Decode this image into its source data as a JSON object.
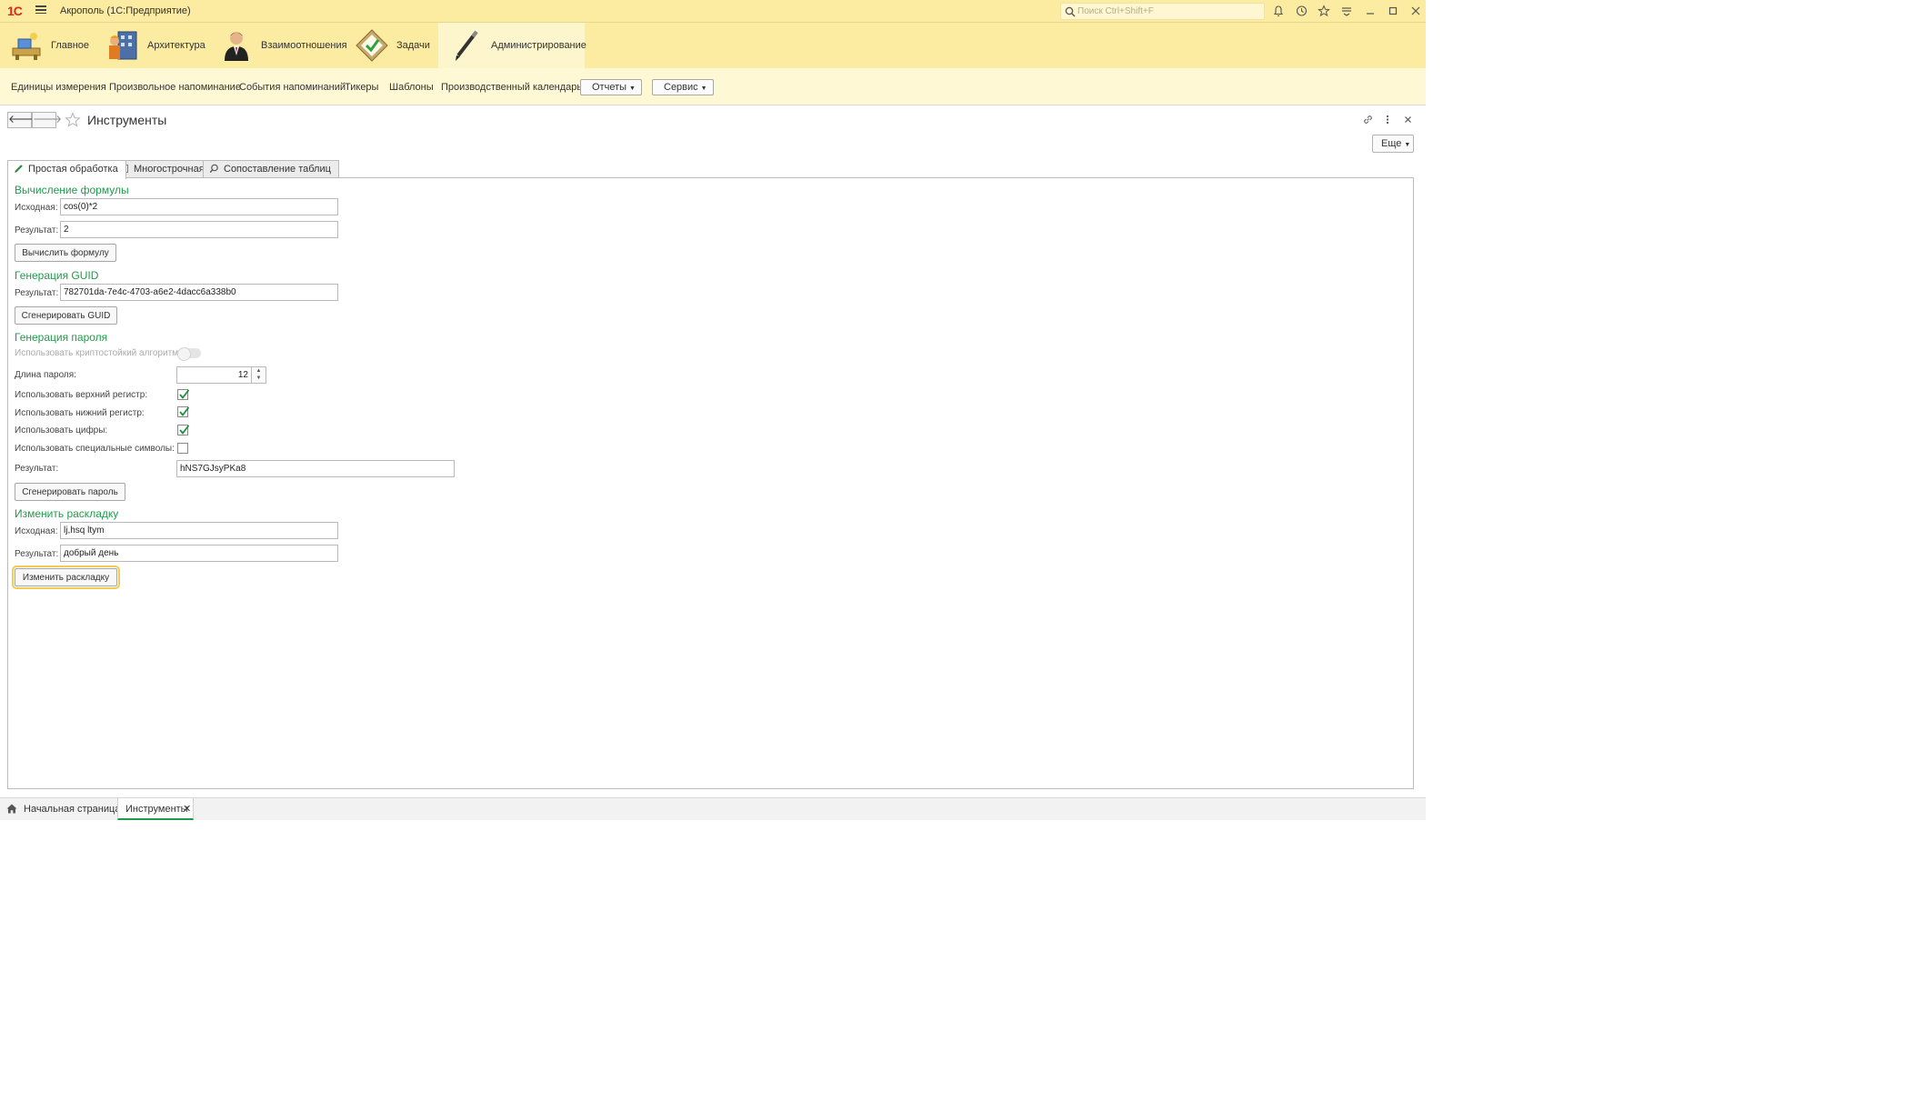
{
  "titlebar": {
    "logo": "1С",
    "app_title": "Акрополь  (1С:Предприятие)",
    "search_placeholder": "Поиск Ctrl+Shift+F"
  },
  "sections": [
    {
      "label": "Главное",
      "icon": "home-desk-icon"
    },
    {
      "label": "Архитектура",
      "icon": "building-worker-icon"
    },
    {
      "label": "Взаимоотношения",
      "icon": "person-icon"
    },
    {
      "label": "Задачи",
      "icon": "task-board-icon"
    },
    {
      "label": "Администрирование",
      "icon": "pen-icon"
    }
  ],
  "commands": {
    "items": [
      "Единицы измерения",
      "Произвольное напоминание",
      "События напоминаний",
      "Тикеры",
      "Шаблоны",
      "Производственный календарь"
    ],
    "reports_label": "Отчеты",
    "service_label": "Сервис"
  },
  "form": {
    "title": "Инструменты",
    "more_label": "Еще",
    "tabs": [
      "Простая обработка",
      "Многострочная",
      "Сопоставление таблиц"
    ]
  },
  "formula": {
    "title": "Вычисление формулы",
    "source_label": "Исходная:",
    "source_value": "cos(0)*2",
    "result_label": "Результат:",
    "result_value": "2",
    "button": "Вычислить формулу"
  },
  "guid": {
    "title": "Генерация GUID",
    "result_label": "Результат:",
    "result_value": "782701da-7e4c-4703-a6e2-4dacc6a338b0",
    "button": "Сгенерировать GUID"
  },
  "password": {
    "title": "Генерация пароля",
    "crypto_label": "Использовать криптостойкий алгоритм:",
    "length_label": "Длина пароля:",
    "length_value": "12",
    "upper_label": "Использовать верхний регистр:",
    "upper_checked": true,
    "lower_label": "Использовать нижний регистр:",
    "lower_checked": true,
    "digits_label": "Использовать цифры:",
    "digits_checked": true,
    "special_label": "Использовать специальные символы:",
    "special_checked": false,
    "result_label": "Результат:",
    "result_value": "hNS7GJsyPKa8",
    "button": "Сгенерировать пароль"
  },
  "layout": {
    "title": "Изменить раскладку",
    "source_label": "Исходная:",
    "source_value": "lj,hsq ltym",
    "result_label": "Результат:",
    "result_value": "добрый день",
    "button": "Изменить раскладку"
  },
  "bottom": {
    "home_label": "Начальная страница",
    "active_label": "Инструменты"
  },
  "colors": {
    "accent_yellow": "#fbeca2",
    "group_green": "#1e9c4b",
    "check_green": "#1a8f3c"
  }
}
